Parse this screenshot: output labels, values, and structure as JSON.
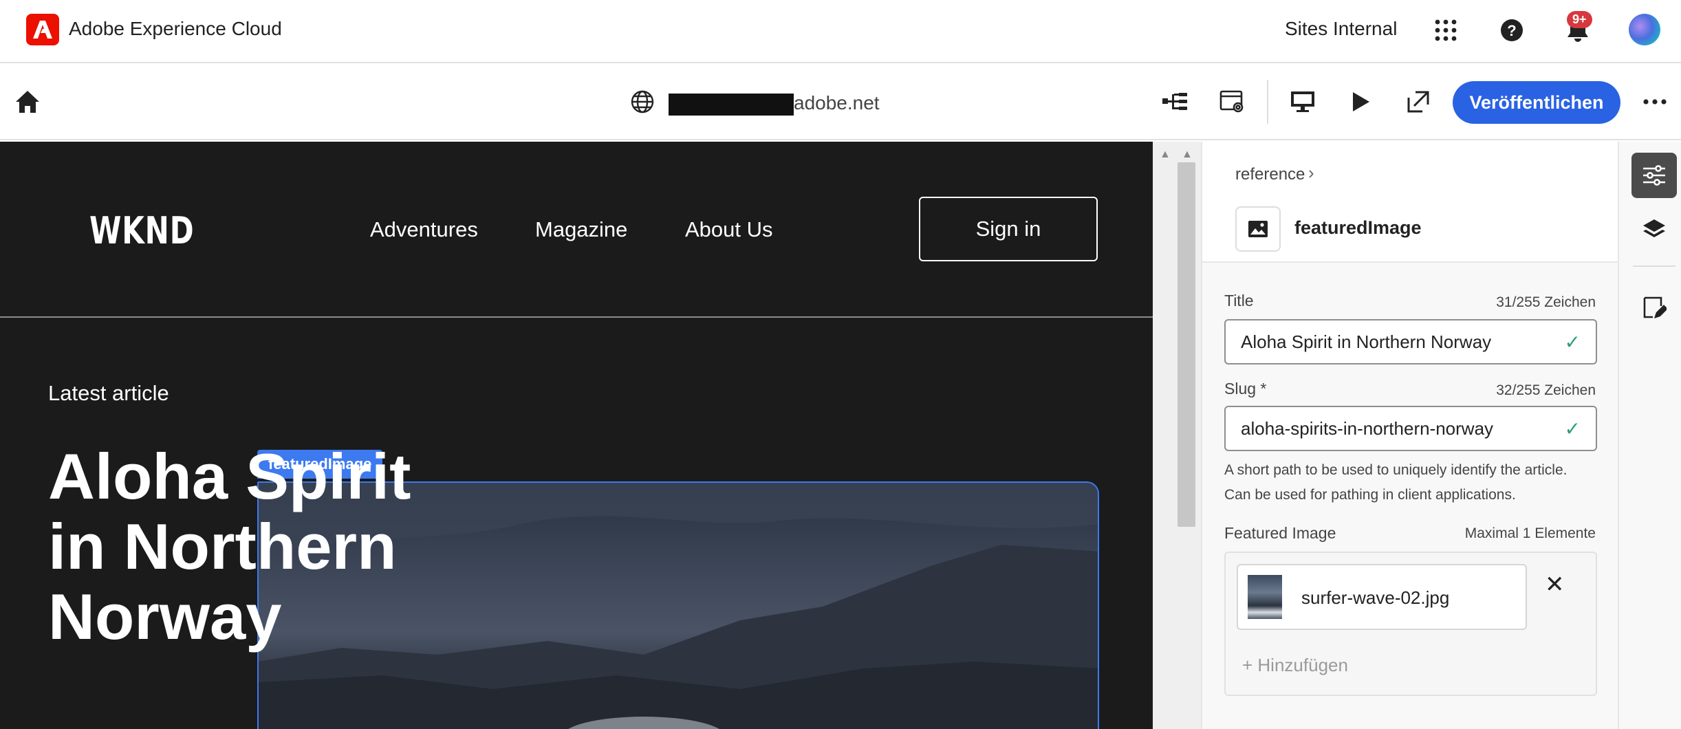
{
  "shell": {
    "brand": "Adobe Experience Cloud",
    "org": "Sites Internal",
    "notifications_badge": "9+",
    "icons": [
      "apps-grid-icon",
      "help-icon",
      "bell-icon"
    ]
  },
  "toolbar": {
    "url_suffix": "adobe.net",
    "publish_label": "Veröffentlichen"
  },
  "site": {
    "logo": "WKND",
    "nav": [
      "Adventures",
      "Magazine",
      "About Us"
    ],
    "signin_label": "Sign in",
    "latest_label": "Latest article",
    "headline_lines": [
      "Aloha Spirit",
      "in Northern",
      "Norway"
    ],
    "selected_component_tag": "featuredImage"
  },
  "panel": {
    "breadcrumb": "reference",
    "component_name": "featuredImage",
    "fields": {
      "title": {
        "label": "Title",
        "count": "31/255 Zeichen",
        "value": "Aloha Spirit in Northern Norway"
      },
      "slug": {
        "label": "Slug *",
        "count": "32/255 Zeichen",
        "value": "aloha-spirits-in-northern-norway"
      }
    },
    "slug_help_line1": "A short path to be used to uniquely identify the article.",
    "slug_help_line2": "Can be used for pathing in client applications.",
    "featured_image": {
      "label": "Featured Image",
      "limit": "Maximal 1 Elemente",
      "item": "surfer-wave-02.jpg",
      "add_label": "+ Hinzufügen"
    }
  },
  "colors": {
    "accent": "#2a62e4",
    "selection": "#3d7af0",
    "adobe_red": "#eb1000",
    "valid": "#2d9d78"
  }
}
